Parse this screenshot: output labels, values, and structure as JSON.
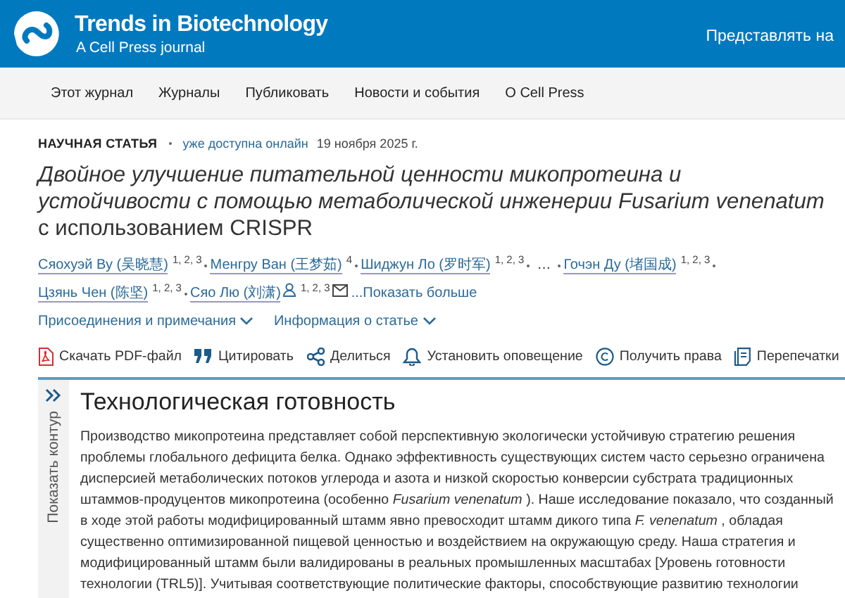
{
  "header": {
    "journal": "Trends in Biotechnology",
    "subtitle": "A Cell Press journal",
    "submit": "Представлять на"
  },
  "nav": [
    "Этот журнал",
    "Журналы",
    "Публиковать",
    "Новости и события",
    "О Cell Press"
  ],
  "article": {
    "type": "НАУЧНАЯ СТАТЬЯ",
    "availability": "уже доступна онлайн",
    "date": "19 ноября 2025 г.",
    "title": "*Двойное улучшение питательной ценности микопротеина и устойчивости с помощью метаболической инженерии Fusarium venenatum* с использованием CRISPR",
    "authors": [
      {
        "kind": "author",
        "name": "Сяохуэй Ву (吴晓慧)",
        "affiliations": "1, 2, 3",
        "corresponding": false
      },
      {
        "kind": "author",
        "name": "Менгру Ван (王梦茹)",
        "affiliations": "4",
        "corresponding": false
      },
      {
        "kind": "author",
        "name": "Шиджун Ло (罗时军)",
        "affiliations": "1, 2, 3",
        "corresponding": false
      },
      {
        "kind": "gap",
        "name": "…"
      },
      {
        "kind": "author",
        "name": "Гочэн Ду (堵国成)",
        "affiliations": "1, 2, 3",
        "corresponding": false
      },
      {
        "kind": "author",
        "name": "Цзянь Чен (陈坚)",
        "affiliations": "1, 2, 3",
        "corresponding": false
      },
      {
        "kind": "author",
        "name": "Сяо Лю (刘潇)",
        "affiliations": "1, 2, 3",
        "corresponding": true
      }
    ],
    "show_more": "...Показать больше",
    "dropdowns": [
      {
        "label": "Присоединения и примечания",
        "expanded": false
      },
      {
        "label": "Информация о статье",
        "expanded": false
      }
    ],
    "actions": [
      {
        "kind": "pdf",
        "label": "Скачать PDF-файл"
      },
      {
        "kind": "cite",
        "label": "Цитировать"
      },
      {
        "kind": "share",
        "label": "Делиться"
      },
      {
        "kind": "alert",
        "label": "Установить оповещение"
      },
      {
        "kind": "rights",
        "label": "Получить права"
      },
      {
        "kind": "reprints",
        "label": "Перепечатки"
      }
    ]
  },
  "outline": {
    "label": "Показать контур"
  },
  "section": {
    "heading": "Технологическая готовность",
    "text": "Производство микопротеина представляет собой перспективную экологически устойчивую стратегию решения проблемы глобального дефицита белка. Однако эффективность существующих систем часто серьезно ограничена дисперсией метаболических потоков углерода и азота и низкой скоростью конверсии субстрата традиционных штаммов-продуцентов микопротеина (особенно *Fusarium venenatum* ). Наше исследование показало, что созданный в ходе этой работы модифицированный штамм явно превосходит штамм дикого типа *F. venenatum* , обладая существенно оптимизированной пищевой ценностью и воздействием на окружающую среду. Наша стратегия и модифицированный штамм были валидированы в реальных промышленных масштабах [Уровень готовности технологии (TRL5)]. Учитывая соответствующие политические факторы, способствующие развитию технологии"
  }
}
